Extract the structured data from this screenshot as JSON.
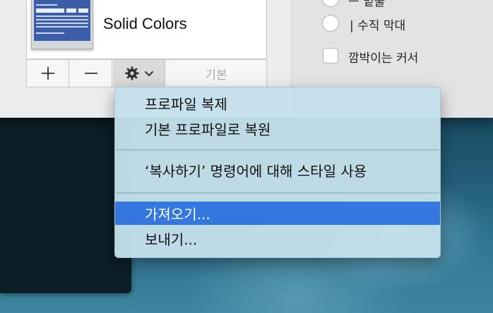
{
  "profile": {
    "name": "Solid Colors",
    "thumbnail_lines": [
      "Terminals",
      "COMMAND",
      "top",
      "Mail",
      "ATSServer",
      "loginwindow",
      "Terminal $"
    ]
  },
  "toolbar": {
    "add_icon": "plus-icon",
    "remove_icon": "minus-icon",
    "settings_icon": "gear-icon",
    "dropdown_icon": "chevron-down-icon",
    "default_label": "기본"
  },
  "cursor_options": {
    "partial_label": "ㅡ 밑줄",
    "vertical_bar_label": "|  수직 막대",
    "blink_label": "깜박이는 커서"
  },
  "context_menu": {
    "items": [
      {
        "label": "프로파일 복제",
        "selected": false
      },
      {
        "label": "기본 프로파일로 복원",
        "selected": false
      },
      {
        "label": "‘복사하기’ 명령어에 대해 스타일 사용",
        "selected": false
      },
      {
        "label": "가져오기...",
        "selected": true
      },
      {
        "label": "보내기...",
        "selected": false
      }
    ]
  },
  "colors": {
    "menu_selection": "#3477de",
    "menu_background": "#c4e0ea",
    "window_background": "#ececec"
  }
}
